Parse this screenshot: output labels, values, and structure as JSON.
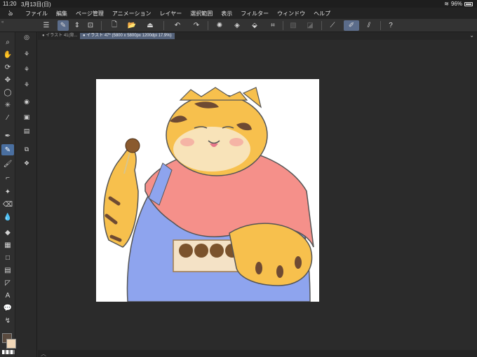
{
  "status": {
    "time": "11:20",
    "date": "3月13日(日)",
    "battery": "96%"
  },
  "menu": [
    {
      "id": "file",
      "label": "ファイル"
    },
    {
      "id": "edit",
      "label": "編集"
    },
    {
      "id": "page",
      "label": "ページ管理"
    },
    {
      "id": "animation",
      "label": "アニメーション"
    },
    {
      "id": "layer",
      "label": "レイヤー"
    },
    {
      "id": "selection",
      "label": "選択範囲"
    },
    {
      "id": "view",
      "label": "表示"
    },
    {
      "id": "filter",
      "label": "フィルター"
    },
    {
      "id": "window",
      "label": "ウィンドウ"
    },
    {
      "id": "help",
      "label": "ヘルプ"
    }
  ],
  "tabs": [
    {
      "label": "● イラスト 41(背..."
    },
    {
      "label": "● イラスト 47* (5800 x 5800px 1200dpi 17.9%)"
    }
  ],
  "icons": {
    "menu": "☰",
    "pen-active": "✎",
    "chevron-up-down": "⇕",
    "transform": "⊡",
    "new": "🗋",
    "open": "📂",
    "save": "⏏",
    "undo": "↶",
    "redo": "↷",
    "spinner": "✺",
    "fill": "◈",
    "bucket": "⬙",
    "crop": "⌗",
    "disabled1": "▧",
    "disabled2": "◪",
    "ruler": "⟋",
    "brush-active": "✐",
    "ruler2": "⫽",
    "help": "?"
  },
  "tools": [
    {
      "id": "zoom",
      "glyph": "⌕"
    },
    {
      "id": "hand",
      "glyph": "✋"
    },
    {
      "id": "rotate",
      "glyph": "⟳"
    },
    {
      "id": "move",
      "glyph": "✥"
    },
    {
      "id": "lasso",
      "glyph": "◯"
    },
    {
      "id": "magic-wand",
      "glyph": "✳"
    },
    {
      "id": "eyedropper",
      "glyph": "⁄"
    },
    {
      "id": "pen",
      "glyph": "✒"
    },
    {
      "id": "pencil",
      "glyph": "✎"
    },
    {
      "id": "brush",
      "glyph": "🖌"
    },
    {
      "id": "airbrush",
      "glyph": "⌐"
    },
    {
      "id": "decoration",
      "glyph": "✦"
    },
    {
      "id": "eraser",
      "glyph": "⌫"
    },
    {
      "id": "blend",
      "glyph": "💧"
    },
    {
      "id": "fill",
      "glyph": "◆"
    },
    {
      "id": "gradient",
      "glyph": "▦"
    },
    {
      "id": "figure",
      "glyph": "□"
    },
    {
      "id": "frame",
      "glyph": "▤"
    },
    {
      "id": "ruler",
      "glyph": "◸"
    },
    {
      "id": "text",
      "glyph": "A"
    },
    {
      "id": "balloon",
      "glyph": "💬"
    },
    {
      "id": "correct-line",
      "glyph": "↯"
    }
  ],
  "subtools": [
    {
      "id": "sub-1",
      "glyph": "◎"
    },
    {
      "id": "sub-2",
      "glyph": "⚘"
    },
    {
      "id": "sub-3",
      "glyph": "⚘"
    },
    {
      "id": "sub-4",
      "glyph": "⚘"
    },
    {
      "id": "sub-5",
      "glyph": "◉"
    },
    {
      "id": "sub-6",
      "glyph": "▣"
    },
    {
      "id": "sub-7",
      "glyph": "▤"
    },
    {
      "id": "sub-8",
      "glyph": "⧉"
    },
    {
      "id": "sub-9",
      "glyph": "❖"
    }
  ],
  "colors": {
    "accent": "#5b6c8a",
    "main_color": "#5a4a3e",
    "sub_color": "#f1d7b7"
  }
}
